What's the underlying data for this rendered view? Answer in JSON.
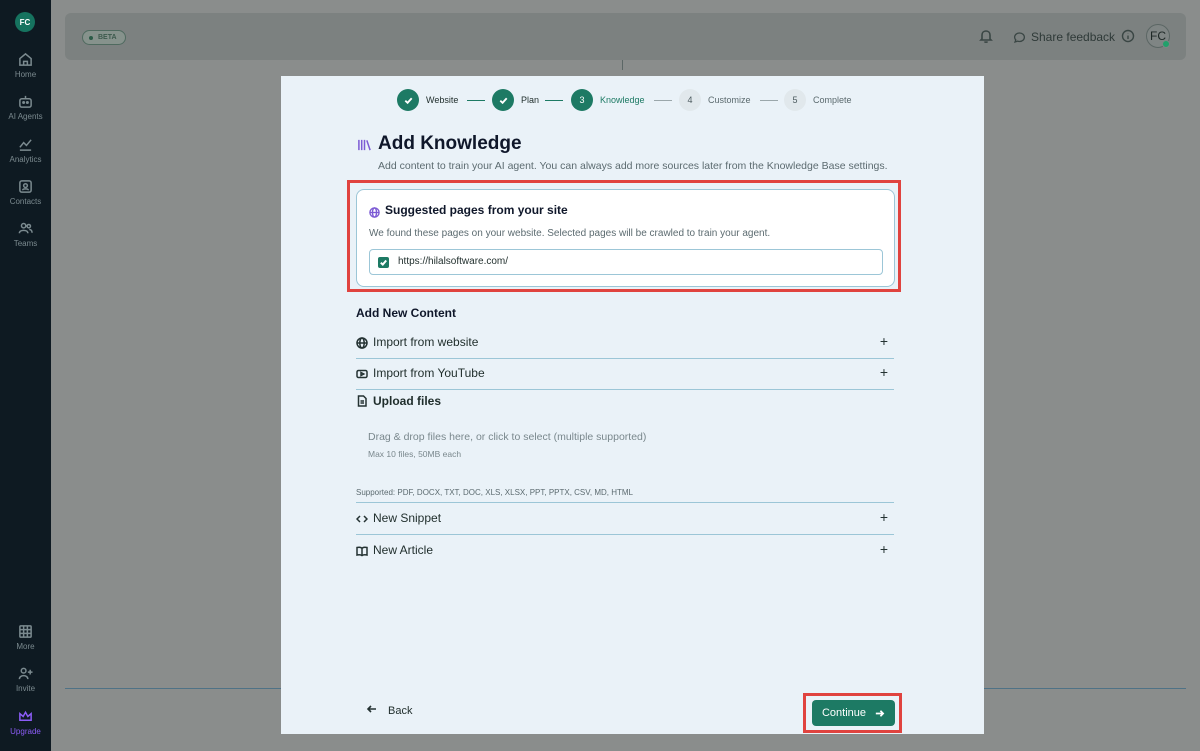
{
  "sidebar": {
    "avatar_initials": "FC",
    "items": [
      {
        "label": "Home",
        "icon": "home-icon"
      },
      {
        "label": "AI Agents",
        "icon": "robot-icon"
      },
      {
        "label": "Analytics",
        "icon": "chart-icon"
      },
      {
        "label": "Contacts",
        "icon": "contacts-icon"
      },
      {
        "label": "Teams",
        "icon": "teams-icon"
      }
    ],
    "bottom_items": [
      {
        "label": "More",
        "icon": "grid-icon"
      },
      {
        "label": "Invite",
        "icon": "invite-icon"
      },
      {
        "label": "Upgrade",
        "icon": "crown-icon"
      }
    ]
  },
  "topbar": {
    "badge": "BETA",
    "feedback_label": "Share feedback",
    "user_initials": "FC"
  },
  "stepper": {
    "steps": [
      {
        "label": "Website",
        "state": "done"
      },
      {
        "label": "Plan",
        "state": "done"
      },
      {
        "number": "3",
        "label": "Knowledge",
        "state": "active"
      },
      {
        "number": "4",
        "label": "Customize",
        "state": "pending"
      },
      {
        "number": "5",
        "label": "Complete",
        "state": "pending"
      }
    ]
  },
  "header": {
    "title": "Add Knowledge",
    "subtitle": "Add content to train your AI agent. You can always add more sources later from the Knowledge Base settings."
  },
  "suggested": {
    "title": "Suggested pages from your site",
    "description": "We found these pages on your website. Selected pages will be crawled to train your agent.",
    "pages": [
      {
        "url": "https://hilalsoftware.com/",
        "checked": true
      }
    ]
  },
  "add_content": {
    "title": "Add New Content",
    "import_website": "Import from website",
    "import_youtube": "Import from YouTube",
    "upload_files": "Upload files",
    "drop_main": "Drag & drop files here, or click to select (multiple supported)",
    "drop_sub": "Max 10 files, 50MB each",
    "supported": "Supported: PDF, DOCX, TXT, DOC, XLS, XLSX, PPT, PPTX, CSV, MD, HTML",
    "new_snippet": "New Snippet",
    "new_article": "New Article",
    "plus": "+"
  },
  "footer": {
    "back_label": "Back",
    "continue_label": "Continue"
  },
  "colors": {
    "accent": "#1d7a64",
    "highlight": "#e0433f",
    "icon_purple": "#7c5ad4",
    "sidebar_bg": "#0e1a22"
  }
}
